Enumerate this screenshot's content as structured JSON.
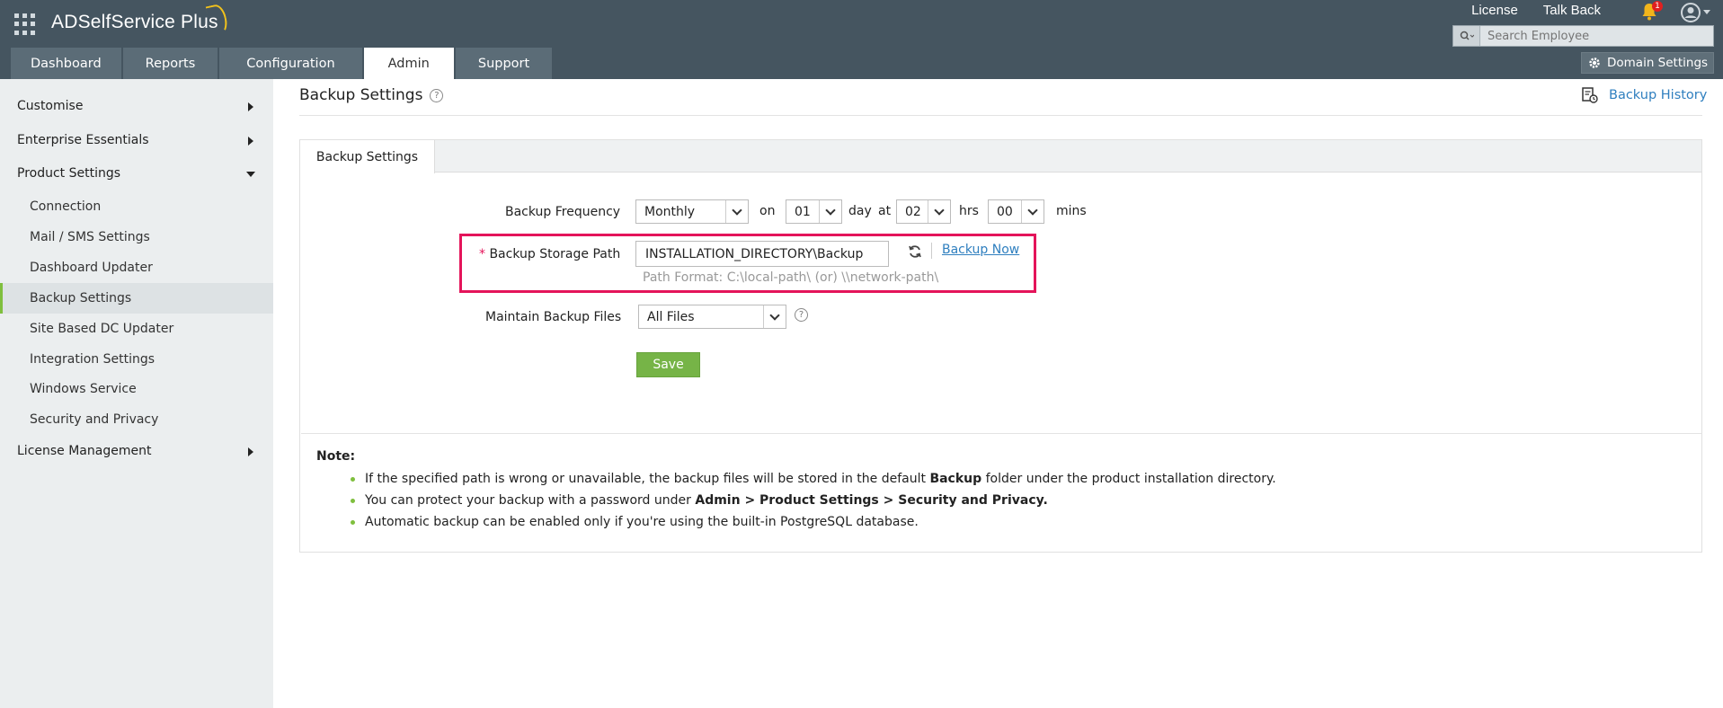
{
  "header": {
    "app_name": "ADSelfService Plus",
    "links": [
      "License",
      "Talk Back"
    ],
    "notification_count": "1",
    "search_placeholder": "Search Employee",
    "domain_settings_label": "Domain Settings"
  },
  "tabs": [
    {
      "label": "Dashboard",
      "active": false
    },
    {
      "label": "Reports",
      "active": false
    },
    {
      "label": "Configuration",
      "active": false
    },
    {
      "label": "Admin",
      "active": true
    },
    {
      "label": "Support",
      "active": false
    }
  ],
  "sidebar": {
    "items": [
      {
        "label": "Customise",
        "level": 0,
        "expanded": false
      },
      {
        "label": "Enterprise Essentials",
        "level": 0,
        "expanded": false
      },
      {
        "label": "Product Settings",
        "level": 0,
        "expanded": true
      },
      {
        "label": "Connection",
        "level": 1
      },
      {
        "label": "Mail / SMS Settings",
        "level": 1
      },
      {
        "label": "Dashboard Updater",
        "level": 1
      },
      {
        "label": "Backup Settings",
        "level": 1,
        "active": true
      },
      {
        "label": "Site Based DC Updater",
        "level": 1
      },
      {
        "label": "Integration Settings",
        "level": 1
      },
      {
        "label": "Windows Service",
        "level": 1
      },
      {
        "label": "Security and Privacy",
        "level": 1
      },
      {
        "label": "License Management",
        "level": 0,
        "expanded": false
      }
    ]
  },
  "page": {
    "title": "Backup Settings",
    "history_label": "Backup History",
    "panel_tab": "Backup Settings"
  },
  "form": {
    "frequency_label": "Backup Frequency",
    "frequency_value": "Monthly",
    "on_label": "on",
    "day_value": "01",
    "day_label": "day",
    "at_label": "at",
    "hour_value": "02",
    "hrs_label": "hrs",
    "min_value": "00",
    "mins_label": "mins",
    "required_mark": "*",
    "storage_path_label": "Backup Storage Path",
    "storage_path_value": "INSTALLATION_DIRECTORY\\Backup",
    "backup_now_label": "Backup Now",
    "path_hint": "Path Format: C:\\local-path\\ (or) \\\\network-path\\",
    "maintain_label": "Maintain Backup Files",
    "maintain_value": "All Files",
    "save_label": "Save"
  },
  "note": {
    "title": "Note:",
    "items": [
      {
        "pre": "If the specified path is wrong or unavailable, the backup files will be stored in the default ",
        "bold": "Backup",
        "post": " folder under the product installation directory."
      },
      {
        "pre": "You can protect your backup with a password under ",
        "bold": "Admin > Product Settings > Security and Privacy.",
        "post": ""
      },
      {
        "pre": "Automatic backup can be enabled only if you're using the built-in PostgreSQL database.",
        "bold": "",
        "post": ""
      }
    ]
  },
  "colors": {
    "header_bg": "#455560",
    "accent_green": "#76b447",
    "highlight_pink": "#e4145a",
    "link_blue": "#2f7fbf"
  }
}
